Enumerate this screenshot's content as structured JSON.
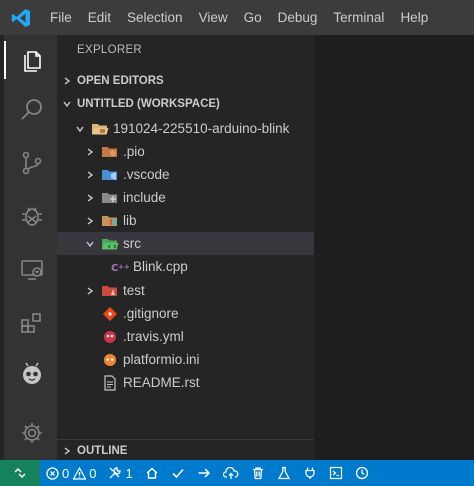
{
  "menu": [
    "File",
    "Edit",
    "Selection",
    "View",
    "Go",
    "Debug",
    "Terminal",
    "Help"
  ],
  "explorer": {
    "title": "EXPLORER",
    "open_editors": "OPEN EDITORS",
    "workspace": "UNTITLED (WORKSPACE)",
    "outline": "OUTLINE",
    "tree": {
      "project": "191024-225510-arduino-blink",
      "pio": ".pio",
      "vscode": ".vscode",
      "include": "include",
      "lib": "lib",
      "src": "src",
      "blink": "Blink.cpp",
      "test": "test",
      "gitignore": ".gitignore",
      "travis": ".travis.yml",
      "platformio": "platformio.ini",
      "readme": "README.rst"
    }
  },
  "status": {
    "errors": "0",
    "warnings": "0",
    "tasks": "1"
  },
  "colors": {
    "statusbar": "#007acc",
    "remote": "#16825d",
    "sidebar": "#252526",
    "activitybar": "#333333",
    "titlebar": "#3c3c3c"
  }
}
